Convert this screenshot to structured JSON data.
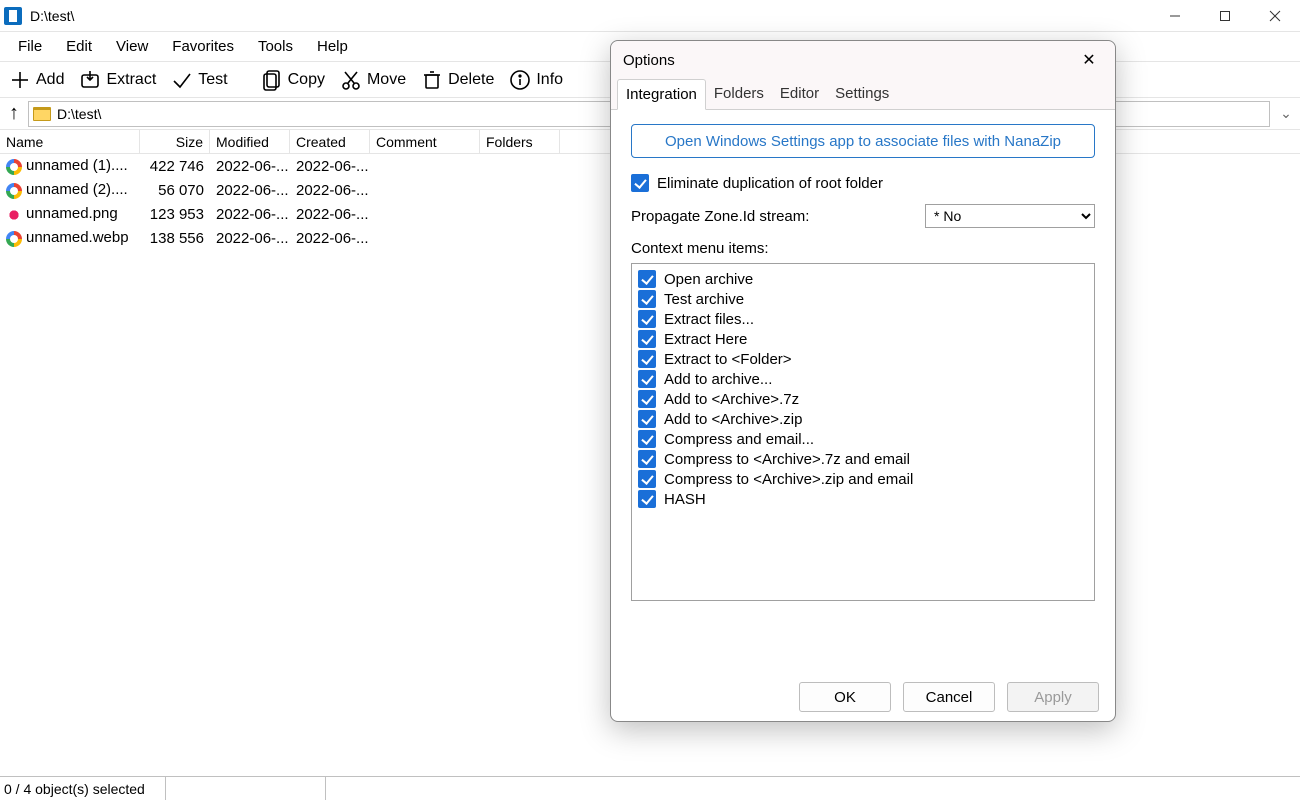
{
  "window": {
    "title": "D:\\test\\"
  },
  "menubar": [
    "File",
    "Edit",
    "View",
    "Favorites",
    "Tools",
    "Help"
  ],
  "toolbar": {
    "add": "Add",
    "extract": "Extract",
    "test": "Test",
    "copy": "Copy",
    "move": "Move",
    "delete": "Delete",
    "info": "Info"
  },
  "address": {
    "path": "D:\\test\\"
  },
  "columns": {
    "name": "Name",
    "size": "Size",
    "modified": "Modified",
    "created": "Created",
    "comment": "Comment",
    "folders": "Folders"
  },
  "files": [
    {
      "icon": "chrome",
      "name": "unnamed (1)....",
      "size": "422 746",
      "modified": "2022-06-...",
      "created": "2022-06-..."
    },
    {
      "icon": "chrome",
      "name": "unnamed (2)....",
      "size": "56 070",
      "modified": "2022-06-...",
      "created": "2022-06-..."
    },
    {
      "icon": "pink",
      "name": "unnamed.png",
      "size": "123 953",
      "modified": "2022-06-...",
      "created": "2022-06-..."
    },
    {
      "icon": "chrome",
      "name": "unnamed.webp",
      "size": "138 556",
      "modified": "2022-06-...",
      "created": "2022-06-..."
    }
  ],
  "status": {
    "selection": "0 / 4 object(s) selected"
  },
  "dialog": {
    "title": "Options",
    "tabs": {
      "integration": "Integration",
      "folders": "Folders",
      "editor": "Editor",
      "settings": "Settings"
    },
    "assoc_button": "Open Windows Settings app to associate files with NanaZip",
    "eliminate_label": "Eliminate duplication of root folder",
    "propagate_label": "Propagate Zone.Id stream:",
    "propagate_value": "* No",
    "context_label": "Context menu items:",
    "context_items": [
      "Open archive",
      "Test archive",
      "Extract files...",
      "Extract Here",
      "Extract to <Folder>",
      "Add to archive...",
      "Add to <Archive>.7z",
      "Add to <Archive>.zip",
      "Compress and email...",
      "Compress to <Archive>.7z and email",
      "Compress to <Archive>.zip and email",
      "HASH"
    ],
    "ok": "OK",
    "cancel": "Cancel",
    "apply": "Apply"
  }
}
